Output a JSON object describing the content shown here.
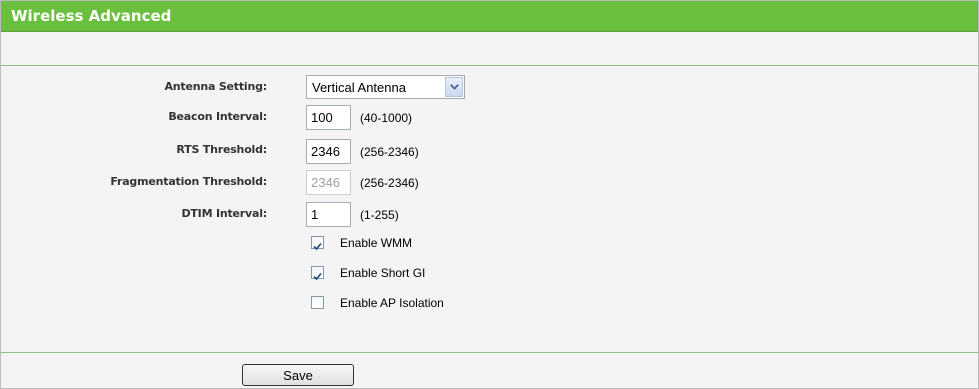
{
  "header": {
    "title": "Wireless Advanced",
    "accent_color": "#6abf3e"
  },
  "form": {
    "antenna": {
      "label": "Antenna Setting:",
      "selected": "Vertical Antenna",
      "icon": "chevron-down-icon"
    },
    "beacon": {
      "label": "Beacon Interval:",
      "value": "100",
      "range": "(40-1000)"
    },
    "rts": {
      "label": "RTS Threshold:",
      "value": "2346",
      "range": "(256-2346)"
    },
    "fragmentation": {
      "label": "Fragmentation Threshold:",
      "value": "2346",
      "range": "(256-2346)",
      "disabled": true
    },
    "dtim": {
      "label": "DTIM Interval:",
      "value": "1",
      "range": "(1-255)"
    },
    "checkboxes": [
      {
        "label": "Enable WMM",
        "checked": true
      },
      {
        "label": "Enable Short GI",
        "checked": true
      },
      {
        "label": "Enable AP Isolation",
        "checked": false
      }
    ]
  },
  "actions": {
    "save_label": "Save"
  }
}
